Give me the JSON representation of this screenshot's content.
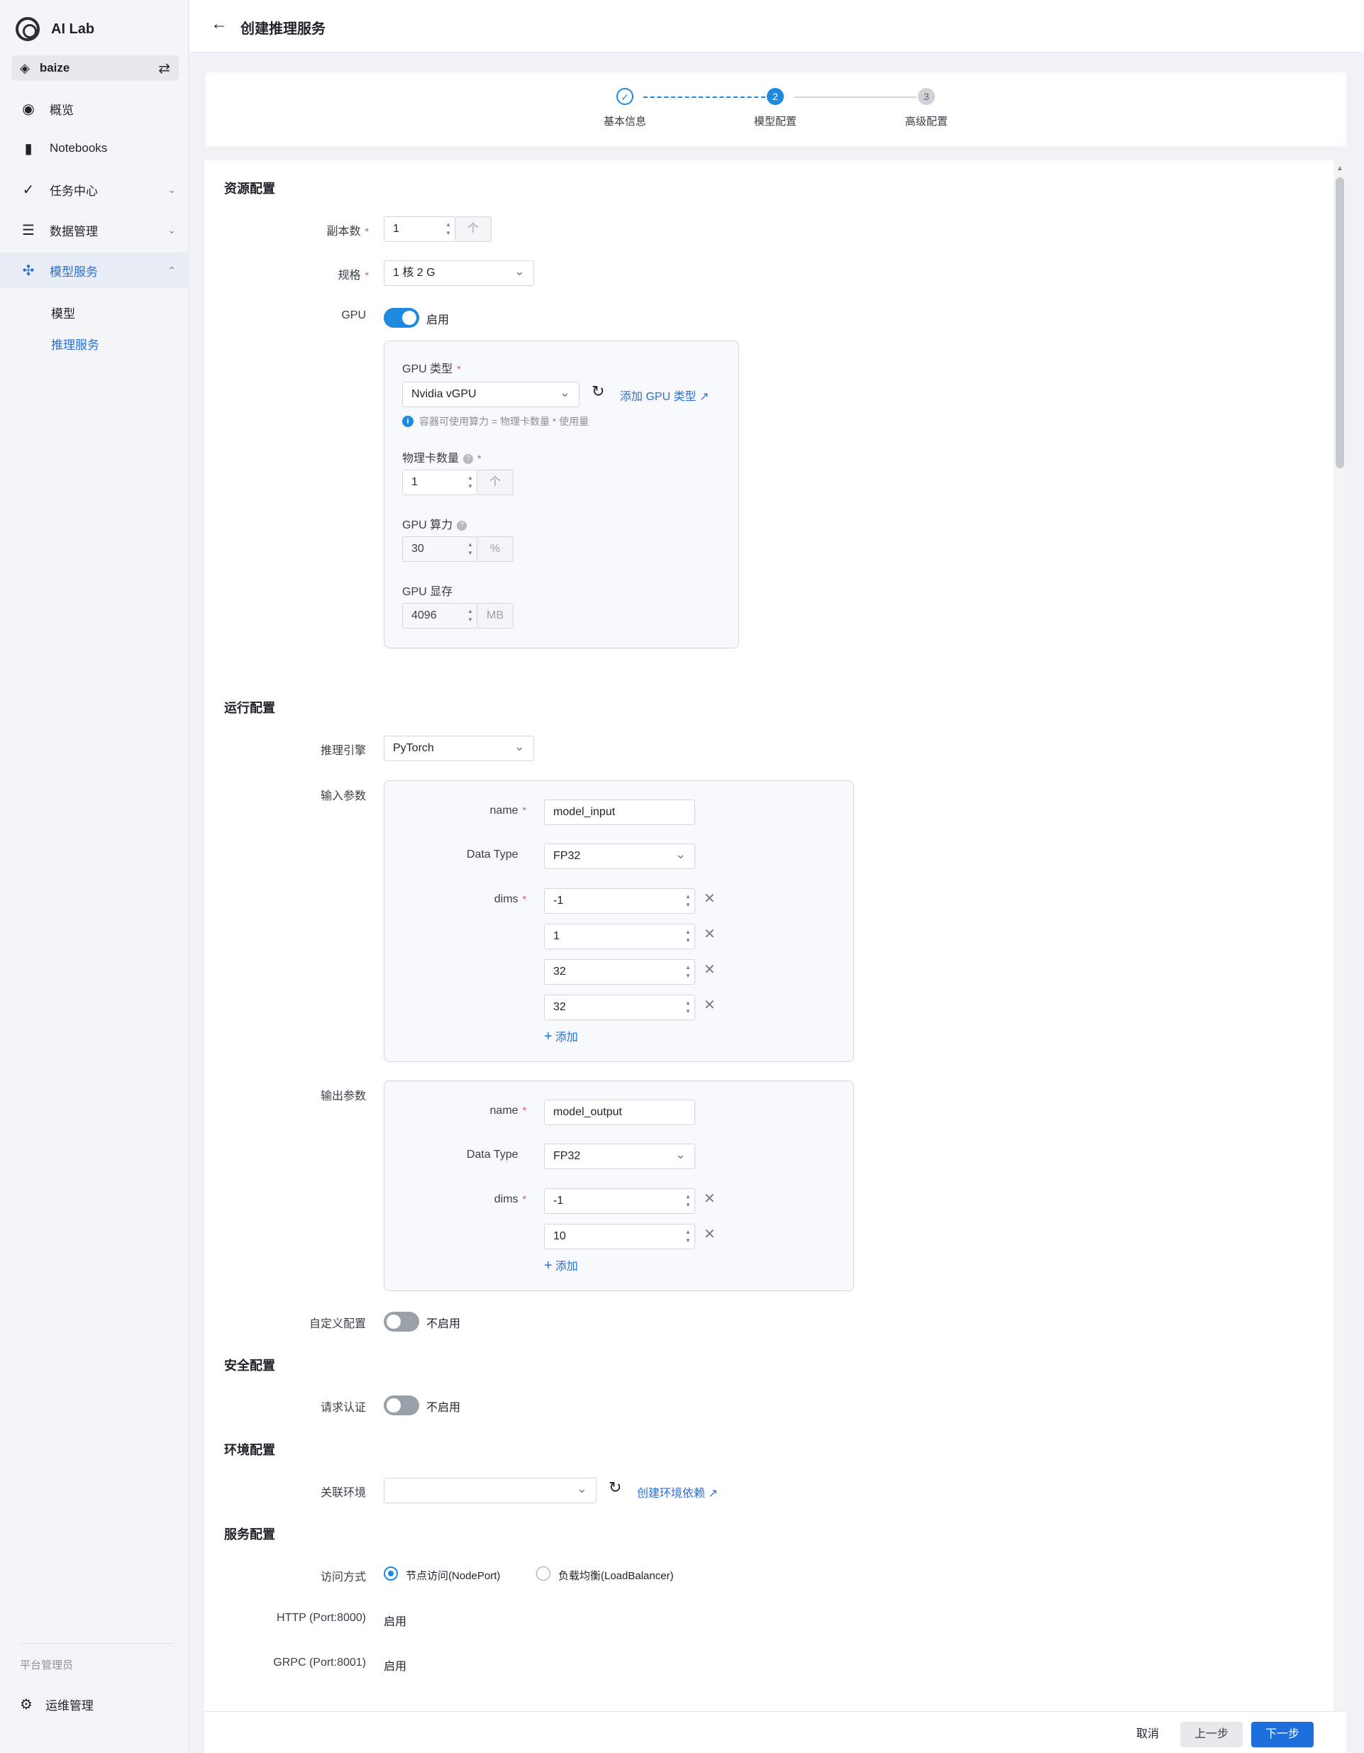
{
  "app": {
    "name": "AI Lab"
  },
  "workspace": {
    "name": "baize"
  },
  "sidebar": {
    "items": [
      {
        "label": "概览"
      },
      {
        "label": "Notebooks"
      },
      {
        "label": "任务中心"
      },
      {
        "label": "数据管理"
      },
      {
        "label": "模型服务"
      }
    ],
    "sub_items": [
      {
        "label": "模型"
      },
      {
        "label": "推理服务"
      }
    ],
    "section_label": "平台管理员",
    "admin_item": "运维管理"
  },
  "header": {
    "title": "创建推理服务"
  },
  "stepper": {
    "steps": [
      {
        "num": "✓",
        "label": "基本信息"
      },
      {
        "num": "2",
        "label": "模型配置"
      },
      {
        "num": "3",
        "label": "高级配置"
      }
    ]
  },
  "resource": {
    "title": "资源配置",
    "replicas_label": "副本数",
    "replicas_value": "1",
    "replicas_unit": "个",
    "spec_label": "规格",
    "spec_value": "1 核 2 G",
    "gpu_label": "GPU",
    "gpu_toggle_label": "启用",
    "gpu_type_label": "GPU 类型",
    "gpu_type_value": "Nvidia vGPU",
    "add_gpu_type": "添加 GPU 类型",
    "gpu_hint": "容器可使用算力 = 物理卡数量 * 使用量",
    "cards_label": "物理卡数量",
    "cards_value": "1",
    "cards_unit": "个",
    "compute_label": "GPU 算力",
    "compute_value": "30",
    "compute_unit": "%",
    "memory_label": "GPU 显存",
    "memory_value": "4096",
    "memory_unit": "MB"
  },
  "runtime": {
    "title": "运行配置",
    "engine_label": "推理引擎",
    "engine_value": "PyTorch",
    "input_label": "输入参数",
    "output_label": "输出参数",
    "name_label": "name",
    "dtype_label": "Data Type",
    "dims_label": "dims",
    "add_label": "添加",
    "input": {
      "name": "model_input",
      "dtype": "FP32",
      "dims": [
        "-1",
        "1",
        "32",
        "32"
      ]
    },
    "output": {
      "name": "model_output",
      "dtype": "FP32",
      "dims": [
        "-1",
        "10"
      ]
    },
    "custom_label": "自定义配置",
    "custom_toggle_label": "不启用"
  },
  "security": {
    "title": "安全配置",
    "auth_label": "请求认证",
    "auth_toggle_label": "不启用"
  },
  "environment": {
    "title": "环境配置",
    "env_label": "关联环境",
    "env_value": "",
    "create_link": "创建环境依赖"
  },
  "service": {
    "title": "服务配置",
    "access_label": "访问方式",
    "options": [
      "节点访问(NodePort)",
      "负载均衡(LoadBalancer)"
    ],
    "selected": "节点访问(NodePort)",
    "http_label": "HTTP (Port:8000)",
    "http_value": "启用",
    "grpc_label": "GRPC (Port:8001)",
    "grpc_value": "启用"
  },
  "footer": {
    "cancel": "取消",
    "prev": "上一步",
    "next": "下一步"
  },
  "colors": {
    "primary": "#1d8ae0",
    "link": "#2b6fd6",
    "required": "#e34d59"
  }
}
